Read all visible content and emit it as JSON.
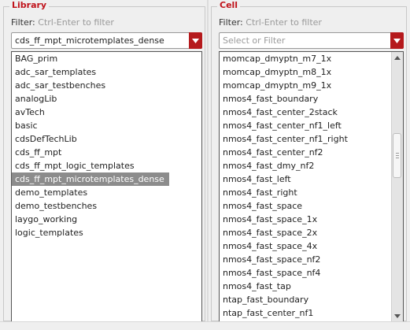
{
  "library": {
    "title": "Library",
    "filter_label": "Filter:",
    "filter_hint": "Ctrl-Enter to filter",
    "combo_value": "cds_ff_mpt_microtemplates_dense",
    "items": [
      "BAG_prim",
      "adc_sar_templates",
      "adc_sar_testbenches",
      "analogLib",
      "avTech",
      "basic",
      "cdsDefTechLib",
      "cds_ff_mpt",
      "cds_ff_mpt_logic_templates",
      "cds_ff_mpt_microtemplates_dense",
      "demo_templates",
      "demo_testbenches",
      "laygo_working",
      "logic_templates"
    ],
    "selected_index": 9
  },
  "cell": {
    "title": "Cell",
    "filter_label": "Filter:",
    "filter_hint": "Ctrl-Enter to filter",
    "combo_placeholder": "Select or Filter",
    "items": [
      "momcap_dmyptn_m7_1x",
      "momcap_dmyptn_m8_1x",
      "momcap_dmyptn_m9_1x",
      "nmos4_fast_boundary",
      "nmos4_fast_center_2stack",
      "nmos4_fast_center_nf1_left",
      "nmos4_fast_center_nf1_right",
      "nmos4_fast_center_nf2",
      "nmos4_fast_dmy_nf2",
      "nmos4_fast_left",
      "nmos4_fast_right",
      "nmos4_fast_space",
      "nmos4_fast_space_1x",
      "nmos4_fast_space_2x",
      "nmos4_fast_space_4x",
      "nmos4_fast_space_nf2",
      "nmos4_fast_space_nf4",
      "nmos4_fast_tap",
      "ntap_fast_boundary",
      "ntap_fast_center_nf1"
    ]
  },
  "colors": {
    "accent": "#c0141c",
    "selection": "#8c8c8c"
  }
}
